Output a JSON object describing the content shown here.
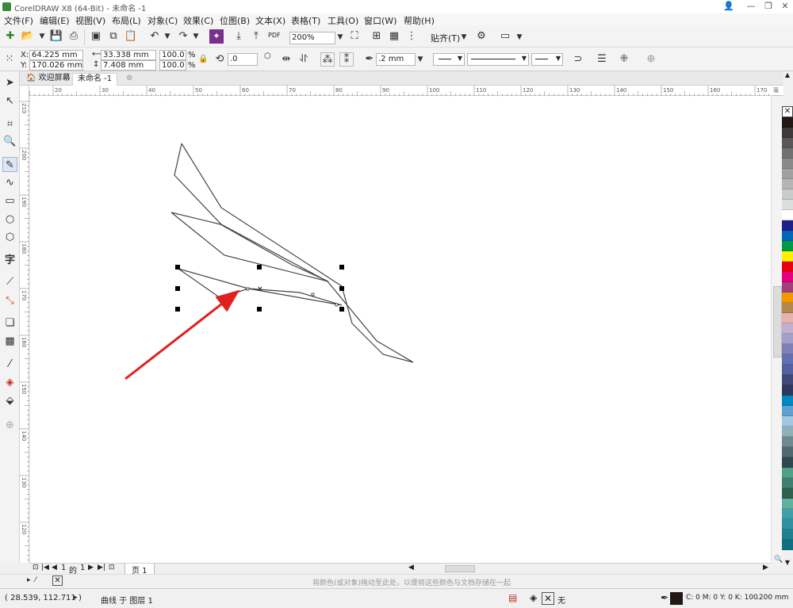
{
  "window": {
    "title": "CorelDRAW X8 (64-Bit) - 未命名 -1"
  },
  "menu": [
    "文件(F)",
    "编辑(E)",
    "视图(V)",
    "布局(L)",
    "对象(C)",
    "效果(C)",
    "位图(B)",
    "文本(X)",
    "表格(T)",
    "工具(O)",
    "窗口(W)",
    "帮助(H)"
  ],
  "standard_toolbar": {
    "zoom": "200%",
    "snap_label": "贴齐(T)",
    "pdf_label": "PDF"
  },
  "property_bar": {
    "x": "64.225 mm",
    "y": "170.026 mm",
    "width": "33.338 mm",
    "height": "7.408 mm",
    "scale_x": "100.0",
    "scale_y": "100.0",
    "percent": "%",
    "x_label": "X:",
    "y_label": "Y:",
    "rotation": ".0",
    "outline_width": ".2 mm"
  },
  "doc_tabs": {
    "welcome": "欢迎屏幕",
    "document": "未命名 -1"
  },
  "rulers": {
    "h_ticks": [
      "20",
      "30",
      "40",
      "50",
      "60",
      "70",
      "80",
      "90",
      "100",
      "110",
      "120",
      "130",
      "140",
      "150",
      "160",
      "170"
    ],
    "h_unit": "毫米",
    "v_ticks": [
      "210",
      "200",
      "190",
      "180",
      "170",
      "160",
      "150",
      "140",
      "130",
      "120"
    ]
  },
  "page_nav": {
    "current": "1",
    "of_label": "的",
    "total": "1",
    "page_tab": "页 1"
  },
  "hint": "将颜色(或对象)拖动至此处，以便将这些颜色与文档存储在一起",
  "status": {
    "cursor": "( 28.539, 112.711 )",
    "object_info": "曲线 于 图层 1",
    "fill_none": "无",
    "outline_color": "C: 0 M: 0 Y: 0 K: 100",
    "outline_width": ".200 mm"
  },
  "palette": [
    "#231815",
    "#3e3a39",
    "#595757",
    "#727171",
    "#898989",
    "#9fa0a0",
    "#b5b5b6",
    "#c9caca",
    "#dcdddd",
    "#ffffff",
    "#1d2088",
    "#0068b7",
    "#009944",
    "#fff100",
    "#e60012",
    "#e4007f",
    "#a0407c",
    "#f39800",
    "#b28850",
    "#e8b0b0",
    "#c0b0d0",
    "#a0a0c8",
    "#8080b8",
    "#6070b0",
    "#5060a0",
    "#404878",
    "#303860",
    "#0088c0",
    "#60a0d0",
    "#a0c8e0",
    "#90b0b8",
    "#708890",
    "#506870",
    "#304850",
    "#50a088",
    "#408070",
    "#306050",
    "#60b0a0",
    "#40a0a8",
    "#3090a0",
    "#208090",
    "#107080"
  ],
  "colors": {
    "arrow": "#e02020",
    "accent": "#7a2e8e"
  },
  "icons": [
    "new-document-icon",
    "open-icon",
    "save-icon",
    "print-icon",
    "import-icon",
    "export-icon",
    "undo-icon",
    "redo-icon",
    "zoom-to-page-icon",
    "gear-icon",
    "pick-tool-icon",
    "shape-tool-icon",
    "crop-tool-icon",
    "zoom-tool-icon",
    "freehand-tool-icon",
    "rectangle-tool-icon",
    "ellipse-tool-icon",
    "polygon-tool-icon",
    "text-tool-icon",
    "eyedropper-icon",
    "fill-icon"
  ]
}
